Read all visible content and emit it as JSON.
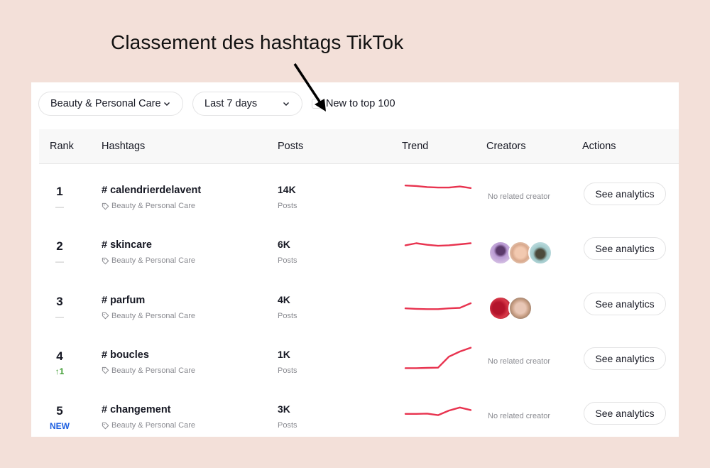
{
  "annotation": {
    "title": "Classement des hashtags TikTok"
  },
  "filters": {
    "category": "Beauty & Personal Care",
    "period": "Last 7 days",
    "new_to_top_label": "New to top 100",
    "new_to_top_checked": false
  },
  "table": {
    "headers": {
      "rank": "Rank",
      "hashtags": "Hashtags",
      "posts": "Posts",
      "trend": "Trend",
      "creators": "Creators",
      "actions": "Actions"
    },
    "rows": [
      {
        "rank": "1",
        "delta": "—",
        "delta_type": "same",
        "hashtag": "# calendrierdelavent",
        "category": "Beauty & Personal Care",
        "posts": "14K",
        "posts_label": "Posts",
        "trend": [
          0.8,
          0.78,
          0.74,
          0.72,
          0.72,
          0.76,
          0.7
        ],
        "creators_text": "No related creator",
        "creators": [],
        "action": "See analytics"
      },
      {
        "rank": "2",
        "delta": "—",
        "delta_type": "same",
        "hashtag": "# skincare",
        "category": "Beauty & Personal Care",
        "posts": "6K",
        "posts_label": "Posts",
        "trend": [
          0.6,
          0.68,
          0.62,
          0.58,
          0.6,
          0.64,
          0.68
        ],
        "creators_text": "",
        "creators": [
          "creator-1",
          "creator-2",
          "creator-3"
        ],
        "action": "See analytics"
      },
      {
        "rank": "3",
        "delta": "—",
        "delta_type": "same",
        "hashtag": "# parfum",
        "category": "Beauty & Personal Care",
        "posts": "4K",
        "posts_label": "Posts",
        "trend": [
          0.3,
          0.28,
          0.27,
          0.27,
          0.3,
          0.32,
          0.5
        ],
        "creators_text": "",
        "creators": [
          "creator-4",
          "creator-5"
        ],
        "action": "See analytics"
      },
      {
        "rank": "4",
        "delta": "↑1",
        "delta_type": "up",
        "hashtag": "# boucles",
        "category": "Beauty & Personal Care",
        "posts": "1K",
        "posts_label": "Posts",
        "trend": [
          0.1,
          0.1,
          0.11,
          0.12,
          0.55,
          0.75,
          0.9
        ],
        "creators_text": "No related creator",
        "creators": [],
        "action": "See analytics"
      },
      {
        "rank": "5",
        "delta": "NEW",
        "delta_type": "new",
        "hashtag": "# changement",
        "category": "Beauty & Personal Care",
        "posts": "3K",
        "posts_label": "Posts",
        "trend": [
          0.45,
          0.45,
          0.46,
          0.4,
          0.58,
          0.7,
          0.6
        ],
        "creators_text": "No related creator",
        "creators": [],
        "action": "See analytics"
      }
    ]
  },
  "colors": {
    "trend_line": "#e8334f",
    "background": "#f3e0d9",
    "up": "#3c9b2f",
    "new": "#1d5fe0"
  }
}
